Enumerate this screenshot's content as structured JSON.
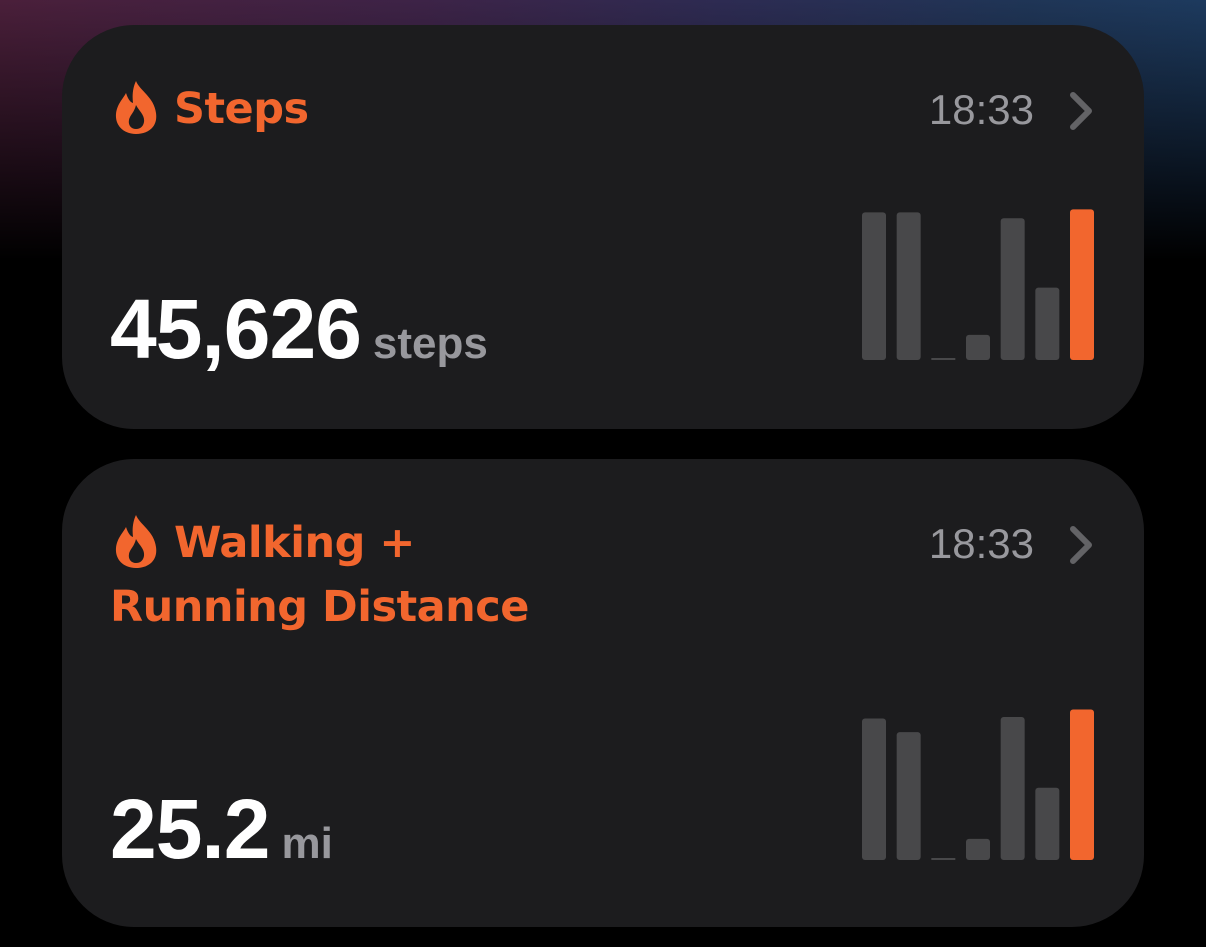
{
  "colors": {
    "accent": "#f2662e",
    "muted": "#98989d",
    "bar": "#48484a",
    "card": "#1c1c1e"
  },
  "cards": [
    {
      "icon": "flame-icon",
      "title": "Steps",
      "title_line2": "",
      "time": "18:33",
      "value": "45,626",
      "unit": "steps",
      "chart_data": {
        "type": "bar",
        "values": [
          1.0,
          1.0,
          0.0,
          0.17,
          0.96,
          0.49,
          1.02
        ],
        "highlight_index": 6,
        "ylim": [
          0,
          1.05
        ]
      }
    },
    {
      "icon": "flame-icon",
      "title": "Walking +",
      "title_line2": "Running Distance",
      "time": "18:33",
      "value": "25.2",
      "unit": "mi",
      "chart_data": {
        "type": "bar",
        "values": [
          0.94,
          0.85,
          0.0,
          0.14,
          0.95,
          0.48,
          1.0
        ],
        "highlight_index": 6,
        "ylim": [
          0,
          1.03
        ]
      }
    }
  ]
}
